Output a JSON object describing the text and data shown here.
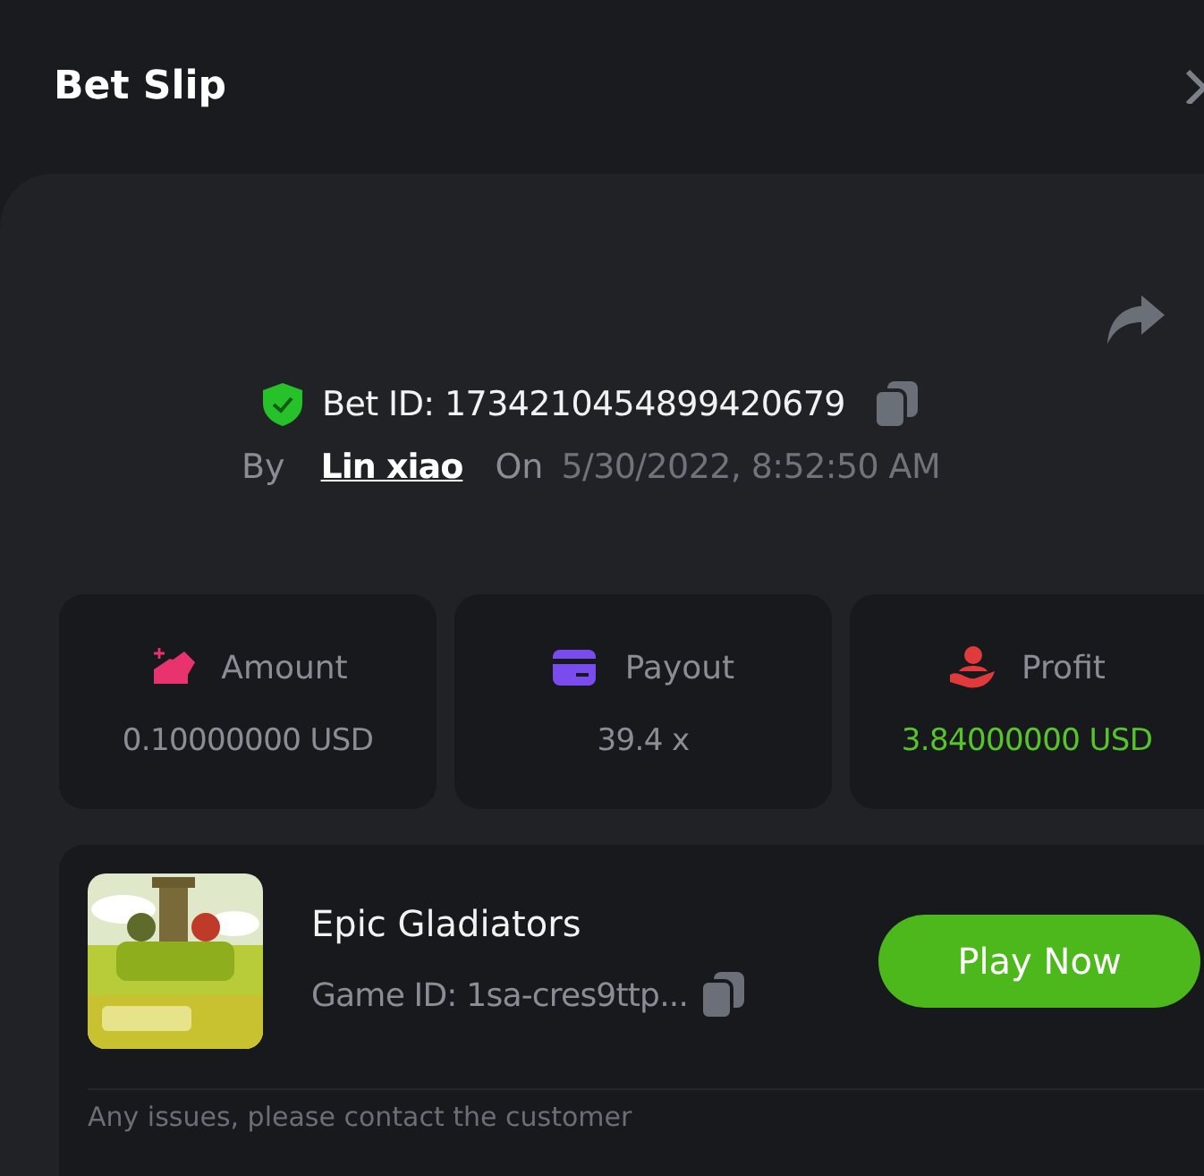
{
  "header": {
    "title": "Bet Slip"
  },
  "bet": {
    "verified": true,
    "id_label": "Bet ID: 1734210454899420679",
    "by_label": "By",
    "user": "Lin xiao",
    "on_label": "On",
    "date": "5/30/2022, 8:52:50 AM"
  },
  "stats": [
    {
      "kind": "amount",
      "label": "Amount",
      "value": "0.10000000 USD",
      "color": "#e8336f",
      "positive": false
    },
    {
      "kind": "payout",
      "label": "Payout",
      "value": "39.4 x",
      "color": "#7a4cf0",
      "positive": false
    },
    {
      "kind": "profit",
      "label": "Profit",
      "value": "3.84000000 USD",
      "color": "#e03a3a",
      "positive": true
    }
  ],
  "game": {
    "name": "Epic Gladiators",
    "id_label": "Game ID: 1sa-cres9ttp...",
    "button": "Play Now"
  },
  "footer": {
    "note": "Any issues, please contact the customer"
  }
}
